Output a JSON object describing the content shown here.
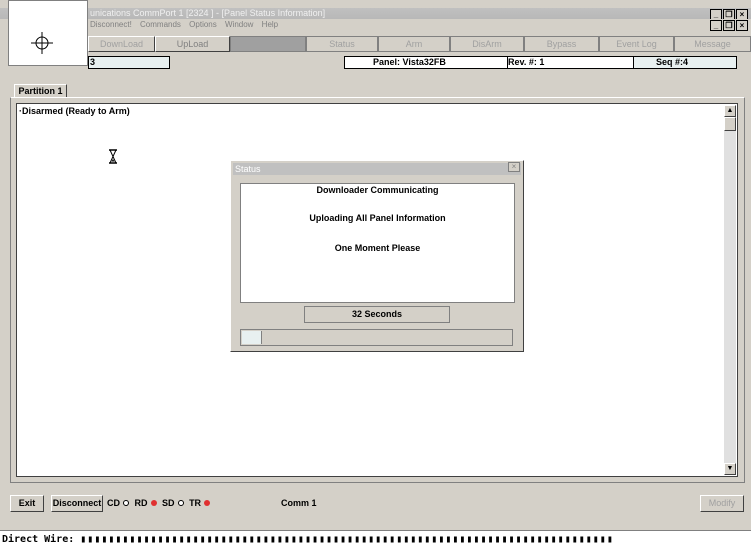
{
  "window": {
    "title": "unications CommPort 1 [2324 ] - [Panel Status Information]",
    "controls": [
      "_",
      "❐",
      "×"
    ],
    "child_controls": [
      "_",
      "❐",
      "×"
    ]
  },
  "menu": {
    "items": [
      "Disconnect!",
      "Commands",
      "Options",
      "Window",
      "Help"
    ]
  },
  "toolbar": {
    "buttons": [
      {
        "label": "DownLoad"
      },
      {
        "label": "UpLoad"
      },
      {
        "label": ""
      },
      {
        "label": "Status"
      },
      {
        "label": "Arm"
      },
      {
        "label": "DisArm"
      },
      {
        "label": "Bypass"
      },
      {
        "label": "Event Log"
      },
      {
        "label": "Message"
      }
    ]
  },
  "info": {
    "account": "3",
    "panel": "Panel:  Vista32FB",
    "rev": "Rev. #:  1",
    "seq": "Seq #:4"
  },
  "partition": {
    "tab_label": "Partition 1",
    "status_text": "·Disarmed  (Ready to Arm)"
  },
  "dialog": {
    "title": "Status",
    "close": "×",
    "line1": "Downloader Communicating",
    "line2": "Uploading All Panel Information",
    "line3": "One Moment Please",
    "seconds": "32  Seconds",
    "progress": 0.07
  },
  "statusbar": {
    "exit": "Exit",
    "disconnect": "Disconnect",
    "cd": "CD",
    "rd": "RD",
    "sd": "SD",
    "tr": "TR",
    "comm": "Comm 1",
    "modify": "Modify"
  },
  "footer": {
    "text": "Direct Wire:"
  },
  "colors": {
    "indicator_on": "#e03030",
    "face": "#d4d0c8"
  }
}
